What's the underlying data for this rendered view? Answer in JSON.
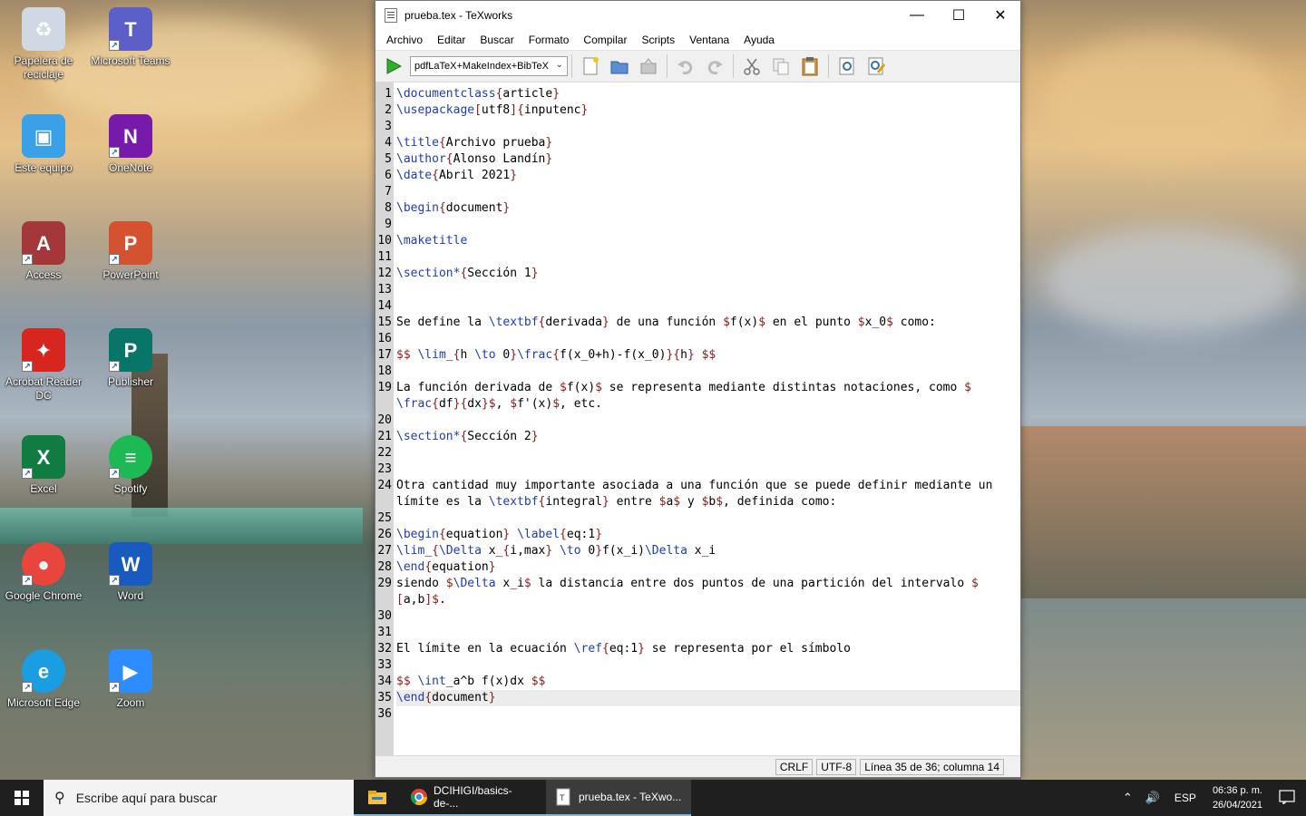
{
  "desktop": {
    "icons": [
      {
        "label": "Papelera de reciclaje",
        "icon": "recycle-bin-icon",
        "color": "#cfd8e3"
      },
      {
        "label": "Microsoft Teams",
        "icon": "teams-icon",
        "color": "#5b5fc7"
      },
      {
        "label": "Este equipo",
        "icon": "computer-icon",
        "color": "#3aa0e8"
      },
      {
        "label": "OneNote",
        "icon": "onenote-icon",
        "color": "#7719aa"
      },
      {
        "label": "Access",
        "icon": "access-icon",
        "color": "#a4373a"
      },
      {
        "label": "PowerPoint",
        "icon": "powerpoint-icon",
        "color": "#d35230"
      },
      {
        "label": "Acrobat Reader DC",
        "icon": "acrobat-icon",
        "color": "#d7261f"
      },
      {
        "label": "Publisher",
        "icon": "publisher-icon",
        "color": "#077568"
      },
      {
        "label": "Excel",
        "icon": "excel-icon",
        "color": "#107c41"
      },
      {
        "label": "Spotify",
        "icon": "spotify-icon",
        "color": "#1db954"
      },
      {
        "label": "Google Chrome",
        "icon": "chrome-icon",
        "color": "#e8453c"
      },
      {
        "label": "Word",
        "icon": "word-icon",
        "color": "#185abd"
      },
      {
        "label": "Microsoft Edge",
        "icon": "edge-icon",
        "color": "#1b9de2"
      },
      {
        "label": "Zoom",
        "icon": "zoom-icon",
        "color": "#2d8cff"
      }
    ]
  },
  "window": {
    "title": "prueba.tex - TeXworks",
    "menu": [
      "Archivo",
      "Editar",
      "Buscar",
      "Formato",
      "Compilar",
      "Scripts",
      "Ventana",
      "Ayuda"
    ],
    "engine": "pdfLaTeX+MakeIndex+BibTeX",
    "status": {
      "eol": "CRLF",
      "encoding": "UTF-8",
      "position": "Línea 35 de 36; columna 14"
    }
  },
  "editor": {
    "line_numbers": [
      "1",
      "2",
      "3",
      "4",
      "5",
      "6",
      "7",
      "8",
      "9",
      "10",
      "11",
      "12",
      "13",
      "14",
      "15",
      "16",
      "17",
      "18",
      "19",
      "",
      "20",
      "21",
      "22",
      "23",
      "24",
      "",
      "25",
      "26",
      "27",
      "28",
      "29",
      "",
      "30",
      "31",
      "32",
      "33",
      "34",
      "35",
      "36"
    ],
    "lines": [
      "\\documentclass{article}",
      "\\usepackage[utf8]{inputenc}",
      "",
      "\\title{Archivo prueba}",
      "\\author{Alonso Landín}",
      "\\date{Abril 2021}",
      "",
      "\\begin{document}",
      "",
      "\\maketitle",
      "",
      "\\section*{Sección 1}",
      "",
      "",
      "Se define la \\textbf{derivada} de una función $f(x)$ en el punto $x_0$ como:",
      "",
      "$$ \\lim_{h \\to 0}\\frac{f(x_0+h)-f(x_0)}{h} $$",
      "",
      "La función derivada de $f(x)$ se representa mediante distintas notaciones, como $",
      "\\frac{df}{dx}$, $f'(x)$, etc.",
      "",
      "\\section*{Sección 2}",
      "",
      "",
      "Otra cantidad muy importante asociada a una función que se puede definir mediante un",
      "límite es la \\textbf{integral} entre $a$ y $b$, definida como:",
      "",
      "\\begin{equation} \\label{eq:1}",
      "\\lim_{\\Delta x_{i,max} \\to 0}f(x_i)\\Delta x_i",
      "\\end{equation}",
      "siendo $\\Delta x_i$ la distancia entre dos puntos de una partición del intervalo $",
      "[a,b]$.",
      "",
      "",
      "El límite en la ecuación \\ref{eq:1} se representa por el símbolo",
      "",
      "$$ \\int_a^b f(x)dx $$",
      "\\end{document}",
      ""
    ],
    "current_line_index": 37
  },
  "taskbar": {
    "search_placeholder": "Escribe aquí para buscar",
    "apps": [
      {
        "label": "",
        "icon": "file-explorer-icon"
      },
      {
        "label": "DCIHIGI/basics-de-...",
        "icon": "chrome-icon"
      },
      {
        "label": "prueba.tex - TeXwo...",
        "icon": "texworks-icon"
      }
    ],
    "language": "ESP",
    "time": "06:36 p. m.",
    "date": "26/04/2021"
  }
}
